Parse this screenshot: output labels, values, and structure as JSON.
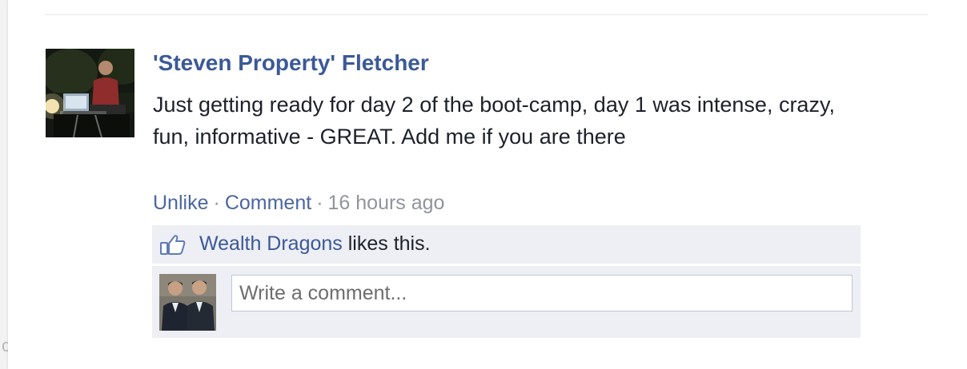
{
  "post": {
    "author_name": "'Steven Property' Fletcher",
    "message": "Just getting ready for day 2 of the boot-camp, day 1 was intense, crazy, fun, informative - GREAT. Add me if you are there",
    "actions": {
      "unlike_label": "Unlike",
      "separator": "·",
      "comment_label": "Comment",
      "timestamp": "16 hours ago"
    },
    "likes": {
      "liker_name": "Wealth Dragons",
      "suffix": " likes this."
    },
    "comment_input": {
      "placeholder": "Write a comment..."
    }
  },
  "page_edge": {
    "partial_text": "c"
  },
  "colors": {
    "link": "#3b5998",
    "action_link": "#4b67a1",
    "muted": "#90949c",
    "likes_bg": "#edeff4"
  },
  "icons": {
    "like": "thumbs-up-icon"
  }
}
